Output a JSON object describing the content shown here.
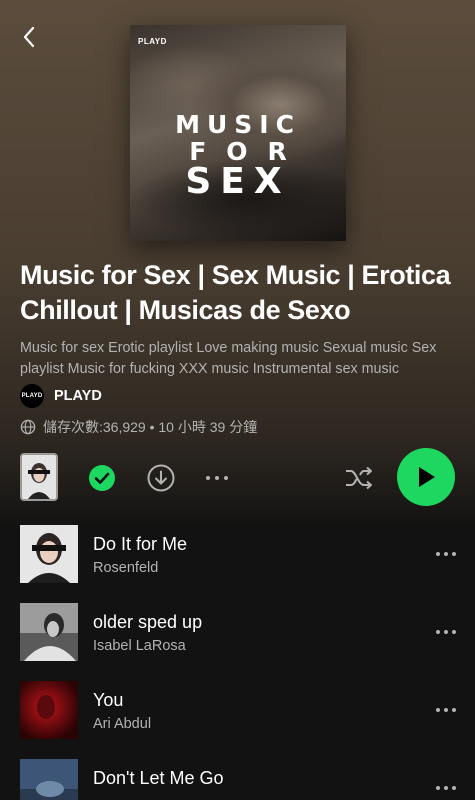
{
  "header": {
    "back_icon": "chevron-left-icon"
  },
  "cover": {
    "brand": "PLAYD",
    "line1": "MUSIC",
    "line2": "FOR",
    "line3": "SEX"
  },
  "playlist": {
    "title": "Music for Sex | Sex Music | Erotica Chillout | Musicas de Sexo",
    "description": "Music for sex Erotic playlist Love making music Sexual music Sex playlist Music for fucking XXX music Instrumental sex music",
    "owner_avatar_text": "PLAYD",
    "owner": "PLAYD",
    "meta": "儲存次數:36,929 • 10 小時 39 分鐘"
  },
  "controls": {
    "saved": true,
    "accent": "#1ed760"
  },
  "tracks": [
    {
      "title": "Do It for Me",
      "artist": "Rosenfeld"
    },
    {
      "title": "older sped up",
      "artist": "Isabel LaRosa"
    },
    {
      "title": "You",
      "artist": "Ari Abdul"
    },
    {
      "title": "Don't Let Me Go",
      "artist": ""
    }
  ]
}
